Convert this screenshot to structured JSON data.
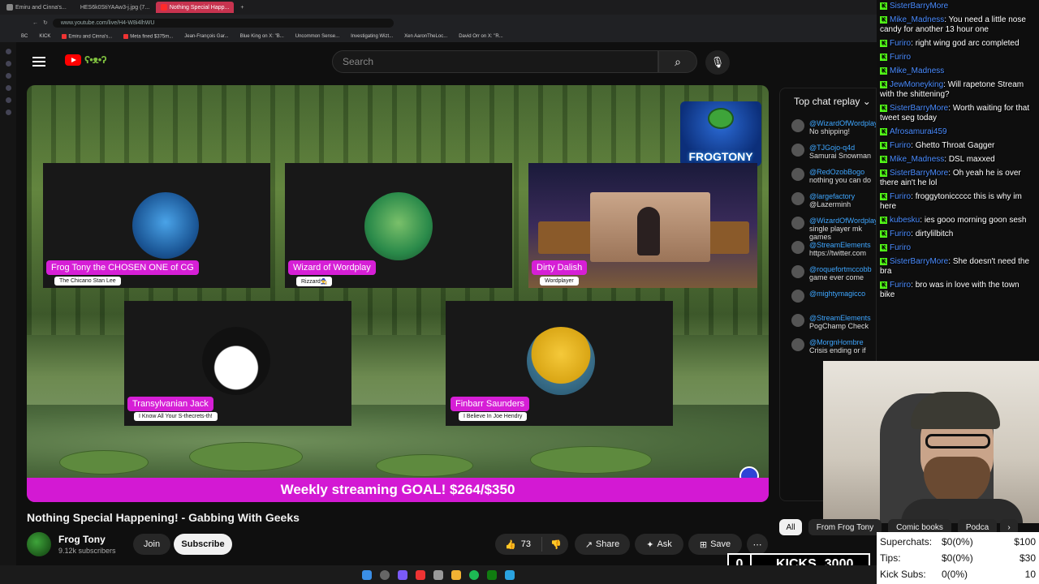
{
  "browser": {
    "tabs": [
      {
        "label": "Emiru and Cinna's...",
        "active": false
      },
      {
        "label": "HES6k0StiYAAw3-j.jpg (7...",
        "active": false
      },
      {
        "label": "Nothing Special Happ...",
        "active": true
      }
    ],
    "url": "www.youtube.com/live/H4-W8i4lhWU",
    "bookmarks": [
      "BC",
      "KICK",
      "Emiru and Cinna's...",
      "Meta fined $375m...",
      "Jean-François Gar...",
      "Blue King on X: \"B...",
      "Uncommon Sense...",
      "Investigating Wizt...",
      "Xen AaronTheLoc...",
      "David Orr on X: \"R..."
    ]
  },
  "header": {
    "search_placeholder": "Search",
    "logo_doodle": "ʕ•ᴥ•ʔ"
  },
  "video": {
    "brand_text": "FROGTONY",
    "participants": [
      {
        "name": "Frog Tony the CHOSEN ONE of CG",
        "tagline": "The Chicano Stan Lee"
      },
      {
        "name": "Wizard of Wordplay",
        "tagline": "Rizzard🧙"
      },
      {
        "name": "Dirty Dalish",
        "tagline": "Wordplayer"
      },
      {
        "name": "Transylvanian Jack",
        "tagline": "I Know All Your S-thecrets-th!"
      },
      {
        "name": "Finbarr Saunders",
        "tagline": "I Believe In Joe Hendry"
      }
    ],
    "goal_text": "Weekly streaming GOAL! $264/$350",
    "title": "Nothing Special Happening! - Gabbing With Geeks"
  },
  "channel": {
    "name": "Frog Tony",
    "subscribers": "9.12k subscribers",
    "join_label": "Join",
    "subscribe_label": "Subscribe"
  },
  "actions": {
    "like_count": "73",
    "share_label": "Share",
    "ask_label": "Ask",
    "save_label": "Save",
    "more_label": "⋯"
  },
  "chat": {
    "header": "Top chat replay",
    "messages": [
      {
        "author": "@WizardOfWordplay",
        "text": "No shipping!"
      },
      {
        "author": "@TJGojo-q4d",
        "text": "Samurai Snowman"
      },
      {
        "author": "@RedOzobBogo",
        "text": "nothing you can do"
      },
      {
        "author": "@largefactory",
        "text": "@Lazerminh"
      },
      {
        "author": "@WizardOfWordplay",
        "text": "single player mk games"
      },
      {
        "author": "@StreamElements",
        "text": "https://twitter.com"
      },
      {
        "author": "@roquefortmccobb",
        "text": "game ever come"
      },
      {
        "author": "@mightymagicco",
        "text": ""
      },
      {
        "author": "@StreamElements",
        "text": "PogChamp Check"
      },
      {
        "author": "@MorgnHombre",
        "text": "Crisis ending or if"
      }
    ]
  },
  "overlay_chat": [
    {
      "author": "SisterBarryMore",
      "text": ""
    },
    {
      "author": "Mike_Madness",
      "text": "You need a little nose candy for another 13 hour one"
    },
    {
      "author": "Furiro",
      "text": "right wing god arc completed"
    },
    {
      "author": "Furiro",
      "text": ""
    },
    {
      "author": "Mike_Madness",
      "text": ""
    },
    {
      "author": "JewMoneyking",
      "text": "Will rapetone Stream with the shittening?"
    },
    {
      "author": "SisterBarryMore",
      "text": "Worth waiting for that tweet seg today"
    },
    {
      "author": "Afrosamurai459",
      "text": ""
    },
    {
      "author": "Furiro",
      "text": "Ghetto Throat Gagger"
    },
    {
      "author": "Mike_Madness",
      "text": "DSL maxxed"
    },
    {
      "author": "SisterBarryMore",
      "text": "Oh yeah he is over there ain't he lol"
    },
    {
      "author": "Furiro",
      "text": "froggytoniccccc this is why im here"
    },
    {
      "author": "kubesku",
      "text": "ies gooo morning goon sesh"
    },
    {
      "author": "Furiro",
      "text": "dirtylilbitch"
    },
    {
      "author": "Furiro",
      "text": ""
    },
    {
      "author": "SisterBarryMore",
      "text": "She doesn't need the bra"
    },
    {
      "author": "Furiro",
      "text": "bro was in love with the town bike"
    }
  ],
  "filters": {
    "all": "All",
    "from_frog_tony": "From Frog Tony",
    "comic_books": "Comic books",
    "podcasts": "Podca"
  },
  "stats": {
    "superchats_label": "Superchats:",
    "superchats_value": "$0(0%)",
    "superchats_goal": "$100",
    "tips_label": "Tips:",
    "tips_value": "$0(0%)",
    "tips_goal": "$30",
    "kick_subs_label": "Kick Subs:",
    "kick_subs_value": "0(0%)",
    "kick_subs_goal": "10"
  },
  "kicks": {
    "count": "0",
    "label": "KICKS",
    "goal": "3000"
  },
  "colors": {
    "accent_magenta": "#d319d3",
    "youtube_red": "#ff0000",
    "kick_green": "#53fc18"
  }
}
